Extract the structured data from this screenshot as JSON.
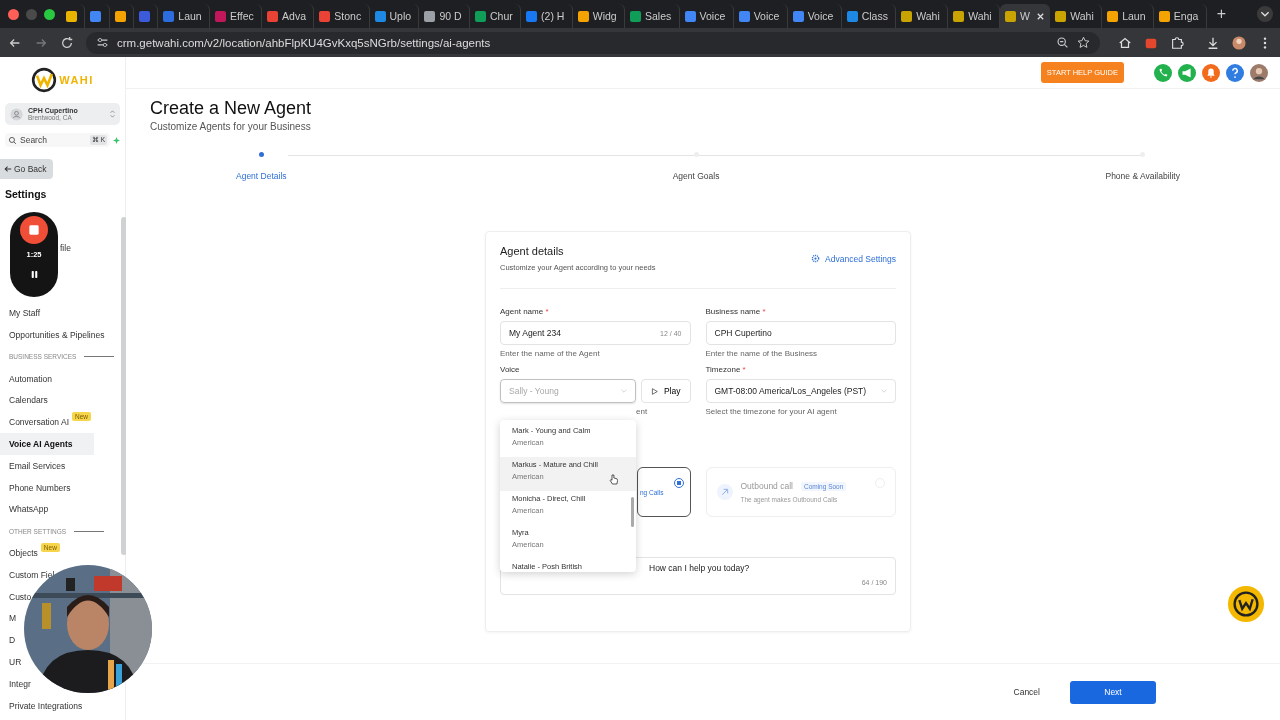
{
  "browser": {
    "tabs": [
      {
        "color": "#e8b400",
        "selected": false
      },
      {
        "color": "#4285f4",
        "selected": false
      },
      {
        "color": "#f4a300",
        "selected": false
      },
      {
        "color": "#3b5bdb",
        "selected": false
      },
      {
        "title": "Laun",
        "color": "#2d6cdf",
        "selected": false
      },
      {
        "title": "Effec",
        "color": "#c2185b",
        "selected": false
      },
      {
        "title": "Adva",
        "color": "#ea4335",
        "selected": false
      },
      {
        "title": "Stonc",
        "color": "#ea4335",
        "selected": false
      },
      {
        "title": "Uplo",
        "color": "#1e88e5",
        "selected": false
      },
      {
        "title": "90 D",
        "color": "#9aa0a6",
        "selected": false
      },
      {
        "title": "Chur",
        "color": "#0f9d58",
        "selected": false
      },
      {
        "title": "(2) H",
        "color": "#1877f2",
        "selected": false
      },
      {
        "title": "Widg",
        "color": "#f4a300",
        "selected": false
      },
      {
        "title": "Sales",
        "color": "#0f9d58",
        "selected": false
      },
      {
        "title": "Voice",
        "color": "#4285f4",
        "selected": false
      },
      {
        "title": "Voice",
        "color": "#4285f4",
        "selected": false
      },
      {
        "title": "Voice",
        "color": "#4285f4",
        "selected": false
      },
      {
        "title": "Class",
        "color": "#1e88e5",
        "selected": false
      },
      {
        "title": "Wahi",
        "color": "#c9a400",
        "selected": false
      },
      {
        "title": "Wahi",
        "color": "#c9a400",
        "selected": false
      },
      {
        "title": "W",
        "color": "#c9a400",
        "selected": true
      },
      {
        "title": "Wahi",
        "color": "#c9a400",
        "selected": false
      },
      {
        "title": "Laun",
        "color": "#f4a300",
        "selected": false
      },
      {
        "title": "Enga",
        "color": "#f4a300",
        "selected": false
      }
    ],
    "new_tab": "+",
    "url": "crm.getwahi.com/v2/location/ahbFlpKU4GvKxq5sNGrb/settings/ai-agents"
  },
  "sidebar": {
    "logo": "WAHI",
    "account": {
      "name": "CPH Cupertino",
      "location": "Brentwood, CA"
    },
    "search": {
      "placeholder": "Search",
      "shortcut": "⌘ K"
    },
    "back": "Go Back",
    "heading": "Settings",
    "items": [
      {
        "kind": "item",
        "label": "file",
        "selected": false
      },
      {
        "kind": "item",
        "label": "My Staff",
        "selected": false
      },
      {
        "kind": "item",
        "label": "Opportunities & Pipelines",
        "selected": false
      },
      {
        "kind": "section",
        "label": "BUSINESS SERVICES"
      },
      {
        "kind": "item",
        "label": "Automation",
        "selected": false
      },
      {
        "kind": "item",
        "label": "Calendars",
        "selected": false
      },
      {
        "kind": "item",
        "label": "Conversation AI",
        "badge": "New",
        "selected": false
      },
      {
        "kind": "item",
        "label": "Voice AI Agents",
        "selected": true
      },
      {
        "kind": "item",
        "label": "Email Services",
        "selected": false
      },
      {
        "kind": "item",
        "label": "Phone Numbers",
        "selected": false
      },
      {
        "kind": "item",
        "label": "WhatsApp",
        "selected": false
      },
      {
        "kind": "section",
        "label": "OTHER SETTINGS"
      },
      {
        "kind": "item",
        "label": "Objects",
        "badge": "New",
        "selected": false
      },
      {
        "kind": "item",
        "label": "Custom Fiel",
        "selected": false
      },
      {
        "kind": "item",
        "label": "Custo",
        "selected": false
      },
      {
        "kind": "item",
        "label": "M",
        "selected": false
      },
      {
        "kind": "item",
        "label": "D",
        "selected": false
      },
      {
        "kind": "item",
        "label": "UR",
        "selected": false
      },
      {
        "kind": "item",
        "label": "Integr",
        "selected": false
      },
      {
        "kind": "item",
        "label": "Private Integrations",
        "selected": false
      }
    ]
  },
  "recorder": {
    "time": "1:25"
  },
  "header": {
    "help_button": "START HELP GUIDE"
  },
  "page": {
    "title": "Create a New Agent",
    "subtitle": "Customize Agents for your Business",
    "steps": [
      {
        "label": "Agent Details",
        "selected": true
      },
      {
        "label": "Agent Goals",
        "selected": false
      },
      {
        "label": "Phone & Availability",
        "selected": false
      }
    ]
  },
  "card": {
    "title": "Agent details",
    "subtitle": "Customize your Agent according to your needs",
    "advanced": "Advanced Settings",
    "agent_name": {
      "label": "Agent name",
      "required": "*",
      "value": "My Agent 234",
      "counter": "12 / 40",
      "help": "Enter the name of the Agent"
    },
    "business_name": {
      "label": "Business name",
      "required": "*",
      "value": "CPH Cupertino",
      "help": "Enter the name of the Business"
    },
    "voice": {
      "label": "Voice",
      "placeholder": "Sally - Young",
      "play": "Play",
      "help": "ent",
      "options": [
        {
          "name": "Mark - Young and Calm",
          "accent": "American",
          "selected": false
        },
        {
          "name": "Markus - Mature and Chill",
          "accent": "American",
          "selected": true
        },
        {
          "name": "Monicha - Direct, Chill",
          "accent": "American",
          "selected": false
        },
        {
          "name": "Myra",
          "accent": "American",
          "selected": false
        },
        {
          "name": "Natalie - Posh British",
          "selected": false
        }
      ]
    },
    "timezone": {
      "label": "Timezone",
      "required": "*",
      "value": "GMT-08:00 America/Los_Angeles (PST)",
      "help": "Select the timezone for your AI agent"
    },
    "inbound": {
      "text": "ng Calls",
      "selected": true
    },
    "outbound": {
      "title": "Outbound call",
      "badge": "Coming Soon",
      "text": "The agent makes Outbound Calls",
      "selected": false
    },
    "greeting": {
      "value": "How can I help you today?",
      "counter": "64 / 190"
    }
  },
  "footer": {
    "cancel": "Cancel",
    "next": "Next"
  }
}
